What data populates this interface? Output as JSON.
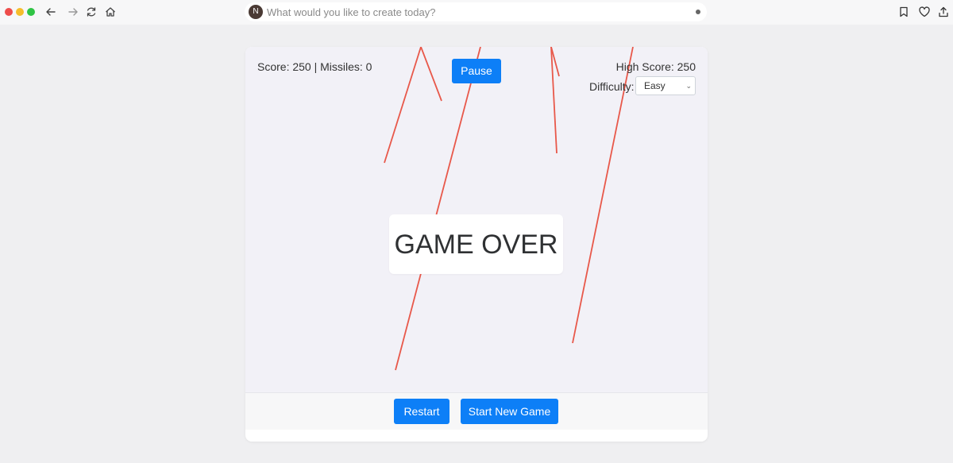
{
  "browser": {
    "avatar_letter": "N",
    "address_placeholder": "What would you like to create today?"
  },
  "game": {
    "score_text": "Score: 250 | Missiles: 0",
    "pause_label": "Pause",
    "high_score_text": "High Score: 250",
    "difficulty_label": "Difficulty:",
    "difficulty_value": "Easy",
    "game_over_text": "GAME OVER",
    "missile_color": "#e8584a"
  },
  "footer": {
    "restart_label": "Restart",
    "new_game_label": "Start New Game"
  },
  "colors": {
    "button_blue": "#0d7ff7",
    "game_background": "#f2f1f7"
  }
}
